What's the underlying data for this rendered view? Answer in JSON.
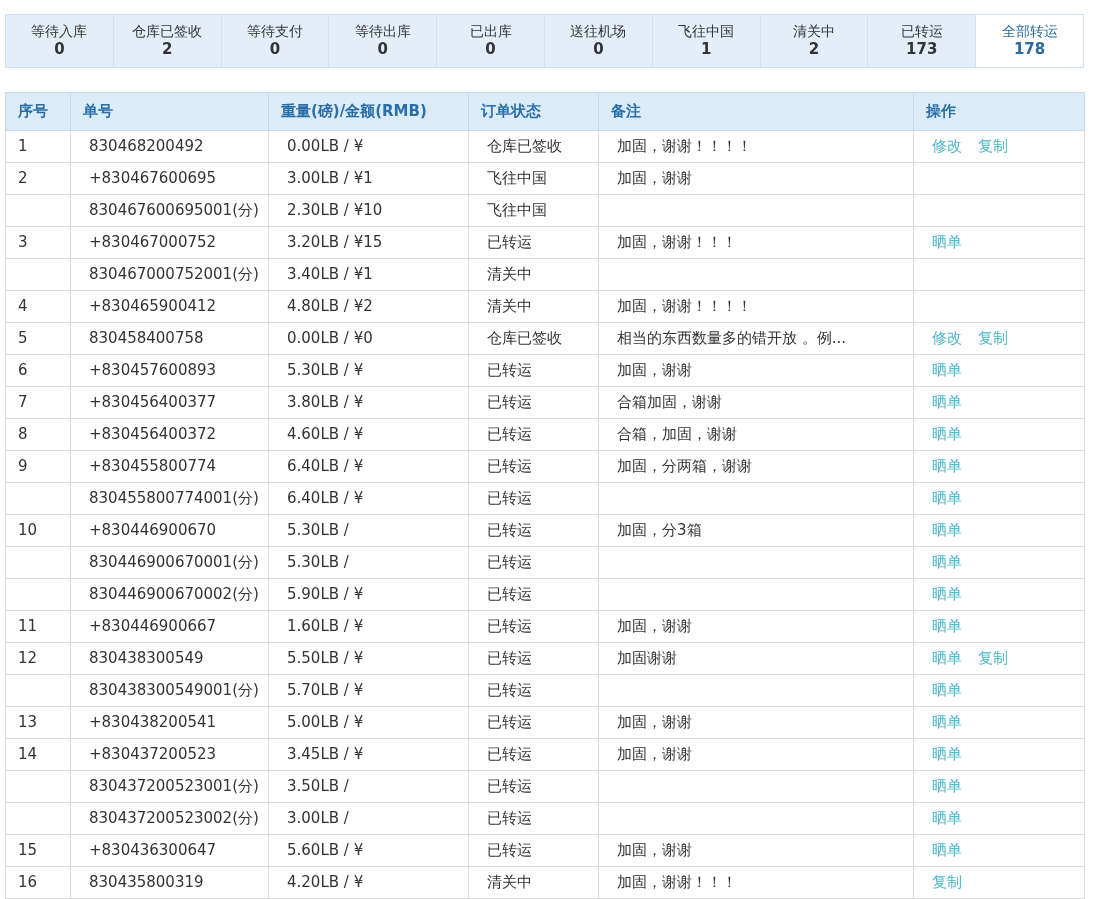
{
  "status_tabs": [
    {
      "label": "等待入库",
      "count": "0",
      "selected": false
    },
    {
      "label": "仓库已签收",
      "count": "2",
      "selected": false
    },
    {
      "label": "等待支付",
      "count": "0",
      "selected": false
    },
    {
      "label": "等待出库",
      "count": "0",
      "selected": false
    },
    {
      "label": "已出库",
      "count": "0",
      "selected": false
    },
    {
      "label": "送往机场",
      "count": "0",
      "selected": false
    },
    {
      "label": "飞往中国",
      "count": "1",
      "selected": false
    },
    {
      "label": "清关中",
      "count": "2",
      "selected": false
    },
    {
      "label": "已转运",
      "count": "173",
      "selected": false
    },
    {
      "label": "全部转运",
      "count": "178",
      "selected": true
    }
  ],
  "table": {
    "columns": [
      "序号",
      "单号",
      "重量(磅)/金额(RMB)",
      "订单状态",
      "备注",
      "操作"
    ],
    "rows": [
      {
        "index": "1",
        "order": "830468200492",
        "weight": "0.00LB / ¥",
        "status": "仓库已签收",
        "note": "加固，谢谢！！！！",
        "actions": [
          "修改",
          "复制"
        ]
      },
      {
        "index": "2",
        "order": "+830467600695",
        "weight": "3.00LB / ¥1",
        "status": "飞往中国",
        "note": "加固，谢谢"
      },
      {
        "order": "830467600695001(分)",
        "weight": "2.30LB / ¥10",
        "status": "飞往中国"
      },
      {
        "index": "3",
        "order": "+830467000752",
        "weight": "3.20LB / ¥15",
        "status": "已转运",
        "note": "加固，谢谢！！！",
        "actions": [
          "晒单"
        ]
      },
      {
        "order": "830467000752001(分)",
        "weight": "3.40LB / ¥1",
        "status": "清关中"
      },
      {
        "index": "4",
        "order": "+830465900412",
        "weight": "4.80LB / ¥2",
        "status": "清关中",
        "note": "加固，谢谢！！！！"
      },
      {
        "index": "5",
        "order": "830458400758",
        "weight": "0.00LB / ¥0",
        "status": "仓库已签收",
        "note": "相当的东西数量多的错开放 。例...",
        "actions": [
          "修改",
          "复制"
        ]
      },
      {
        "index": "6",
        "order": "+830457600893",
        "weight": "5.30LB / ¥",
        "status": "已转运",
        "note": "加固，谢谢",
        "actions": [
          "晒单"
        ]
      },
      {
        "index": "7",
        "order": "+830456400377",
        "weight": "3.80LB / ¥",
        "status": "已转运",
        "note": "合箱加固，谢谢",
        "actions": [
          "晒单"
        ]
      },
      {
        "index": "8",
        "order": "+830456400372",
        "weight": "4.60LB / ¥",
        "status": "已转运",
        "note": "合箱，加固，谢谢",
        "actions": [
          "晒单"
        ]
      },
      {
        "index": "9",
        "order": "+830455800774",
        "weight": "6.40LB / ¥",
        "status": "已转运",
        "note": "加固，分两箱，谢谢",
        "actions": [
          "晒单"
        ]
      },
      {
        "order": "830455800774001(分)",
        "weight": "6.40LB / ¥",
        "status": "已转运",
        "actions": [
          "晒单"
        ]
      },
      {
        "index": "10",
        "order": "+830446900670",
        "weight": "5.30LB /",
        "status": "已转运",
        "note": "加固，分3箱",
        "actions": [
          "晒单"
        ]
      },
      {
        "order": "830446900670001(分)",
        "weight": "5.30LB /",
        "status": "已转运",
        "actions": [
          "晒单"
        ]
      },
      {
        "order": "830446900670002(分)",
        "weight": "5.90LB / ¥",
        "status": "已转运",
        "actions": [
          "晒单"
        ]
      },
      {
        "index": "11",
        "order": "+830446900667",
        "weight": "1.60LB / ¥",
        "status": "已转运",
        "note": "加固，谢谢",
        "actions": [
          "晒单"
        ]
      },
      {
        "index": "12",
        "order": "830438300549",
        "weight": "5.50LB / ¥",
        "status": "已转运",
        "note": "加固谢谢",
        "actions": [
          "晒单",
          "复制"
        ]
      },
      {
        "order": "830438300549001(分)",
        "weight": "5.70LB / ¥",
        "status": "已转运",
        "actions": [
          "晒单"
        ]
      },
      {
        "index": "13",
        "order": "+830438200541",
        "weight": "5.00LB / ¥",
        "status": "已转运",
        "note": "加固，谢谢",
        "actions": [
          "晒单"
        ]
      },
      {
        "index": "14",
        "order": "+830437200523",
        "weight": "3.45LB / ¥",
        "status": "已转运",
        "note": "加固，谢谢",
        "actions": [
          "晒单"
        ]
      },
      {
        "order": "830437200523001(分)",
        "weight": "3.50LB /",
        "status": "已转运",
        "actions": [
          "晒单"
        ]
      },
      {
        "order": "830437200523002(分)",
        "weight": "3.00LB /",
        "status": "已转运",
        "actions": [
          "晒单"
        ]
      },
      {
        "index": "15",
        "order": "+830436300647",
        "weight": "5.60LB / ¥",
        "status": "已转运",
        "note": "加固，谢谢",
        "actions": [
          "晒单"
        ]
      },
      {
        "index": "16",
        "order": "830435800319",
        "weight": "4.20LB / ¥",
        "status": "清关中",
        "note": "加固，谢谢！！！",
        "actions": [
          "复制"
        ]
      }
    ]
  }
}
